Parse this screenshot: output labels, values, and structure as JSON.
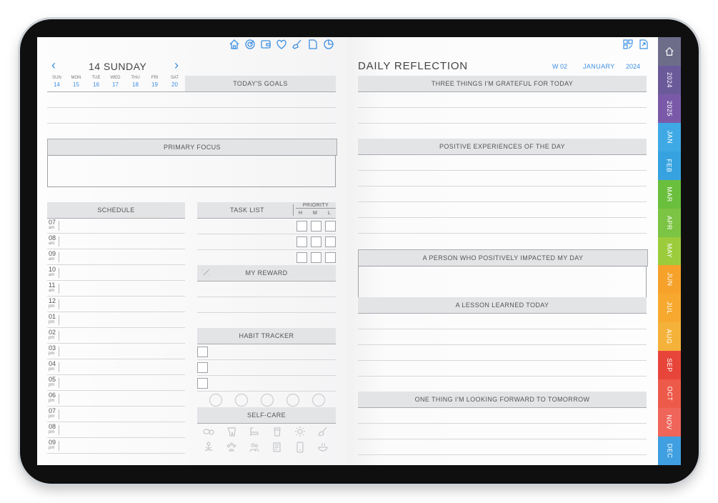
{
  "left": {
    "date_title": "14 SUNDAY",
    "prev": "‹",
    "next": "›",
    "days": [
      {
        "name": "SUN",
        "num": "14"
      },
      {
        "name": "MON",
        "num": "15"
      },
      {
        "name": "TUE",
        "num": "16"
      },
      {
        "name": "WED",
        "num": "17"
      },
      {
        "name": "THU",
        "num": "18"
      },
      {
        "name": "FRI",
        "num": "19"
      },
      {
        "name": "SAT",
        "num": "20"
      }
    ],
    "todays_goals": "TODAY'S GOALS",
    "primary_focus": "PRIMARY FOCUS",
    "schedule": "SCHEDULE",
    "task_list": "TASK LIST",
    "priority": "PRIORITY",
    "priority_h": "H",
    "priority_m": "M",
    "priority_l": "L",
    "my_reward": "MY REWARD",
    "habit_tracker": "HABIT TRACKER",
    "self_care": "SELF-CARE",
    "hours": [
      {
        "h": "07",
        "ap": "am"
      },
      {
        "h": "08",
        "ap": "am"
      },
      {
        "h": "09",
        "ap": "am"
      },
      {
        "h": "10",
        "ap": "am"
      },
      {
        "h": "11",
        "ap": "am"
      },
      {
        "h": "12",
        "ap": "pm"
      },
      {
        "h": "01",
        "ap": "pm"
      },
      {
        "h": "02",
        "ap": "pm"
      },
      {
        "h": "03",
        "ap": "pm"
      },
      {
        "h": "04",
        "ap": "pm"
      },
      {
        "h": "05",
        "ap": "pm"
      },
      {
        "h": "06",
        "ap": "pm"
      },
      {
        "h": "07",
        "ap": "pm"
      },
      {
        "h": "08",
        "ap": "pm"
      },
      {
        "h": "09",
        "ap": "pm"
      }
    ]
  },
  "right": {
    "title": "DAILY REFLECTION",
    "week": "W 02",
    "month": "JANUARY",
    "year": "2024",
    "grateful": "THREE THINGS I'M GRATEFUL FOR TODAY",
    "positive": "POSITIVE EXPERIENCES OF THE DAY",
    "person": "A PERSON WHO POSITIVELY IMPACTED MY DAY",
    "lesson": "A LESSON LEARNED TODAY",
    "forward": "ONE THING I'M LOOKING FORWARD TO TOMORROW"
  },
  "tabs": [
    {
      "label": "home",
      "color": "#6d6d8a"
    },
    {
      "label": "2024",
      "color": "#6a5a9a"
    },
    {
      "label": "2025",
      "color": "#7a5aa8"
    },
    {
      "label": "JAN",
      "color": "#3fa9e6"
    },
    {
      "label": "FEB",
      "color": "#36a3e0"
    },
    {
      "label": "MAR",
      "color": "#6abf3c"
    },
    {
      "label": "APR",
      "color": "#7cc443"
    },
    {
      "label": "MAY",
      "color": "#9ccc3c"
    },
    {
      "label": "JUN",
      "color": "#f6a12a"
    },
    {
      "label": "JUL",
      "color": "#f7a92f"
    },
    {
      "label": "AUG",
      "color": "#f5b23a"
    },
    {
      "label": "SEP",
      "color": "#e8453a"
    },
    {
      "label": "OCT",
      "color": "#ee5a4a"
    },
    {
      "label": "NOV",
      "color": "#f0655a"
    },
    {
      "label": "DEC",
      "color": "#3f9fe0"
    }
  ],
  "colors": {
    "accent": "#3d8fe0",
    "band": "#e3e4e6"
  },
  "top_icons": [
    "home-icon",
    "target-icon",
    "wallet-icon",
    "heart-icon",
    "broom-icon",
    "note-icon",
    "pie-chart-icon"
  ],
  "top_right_icons": [
    "grid-edit-icon",
    "page-link-icon"
  ]
}
